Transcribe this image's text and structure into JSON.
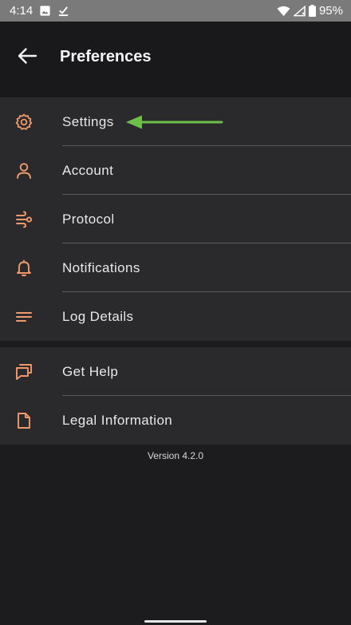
{
  "status_bar": {
    "time": "4:14",
    "battery": "95%",
    "icons": [
      "image-icon",
      "download-done-icon",
      "wifi-icon",
      "signal-icon",
      "battery-icon"
    ]
  },
  "header": {
    "back_icon": "arrow-left-icon",
    "title": "Preferences"
  },
  "sections": [
    {
      "items": [
        {
          "label": "Settings",
          "icon": "gear-icon"
        },
        {
          "label": "Account",
          "icon": "person-icon"
        },
        {
          "label": "Protocol",
          "icon": "protocol-icon"
        },
        {
          "label": "Notifications",
          "icon": "bell-icon"
        },
        {
          "label": "Log Details",
          "icon": "lines-icon"
        }
      ]
    },
    {
      "items": [
        {
          "label": "Get Help",
          "icon": "chat-bubbles-icon"
        },
        {
          "label": "Legal Information",
          "icon": "document-icon"
        }
      ]
    }
  ],
  "version": "Version 4.2.0",
  "colors": {
    "accent": "#f09a6b",
    "annotation_arrow": "#6cc04a",
    "background": "#1c1c1e",
    "row_background": "#2a2a2c",
    "status_bar": "#7a7a7a"
  }
}
